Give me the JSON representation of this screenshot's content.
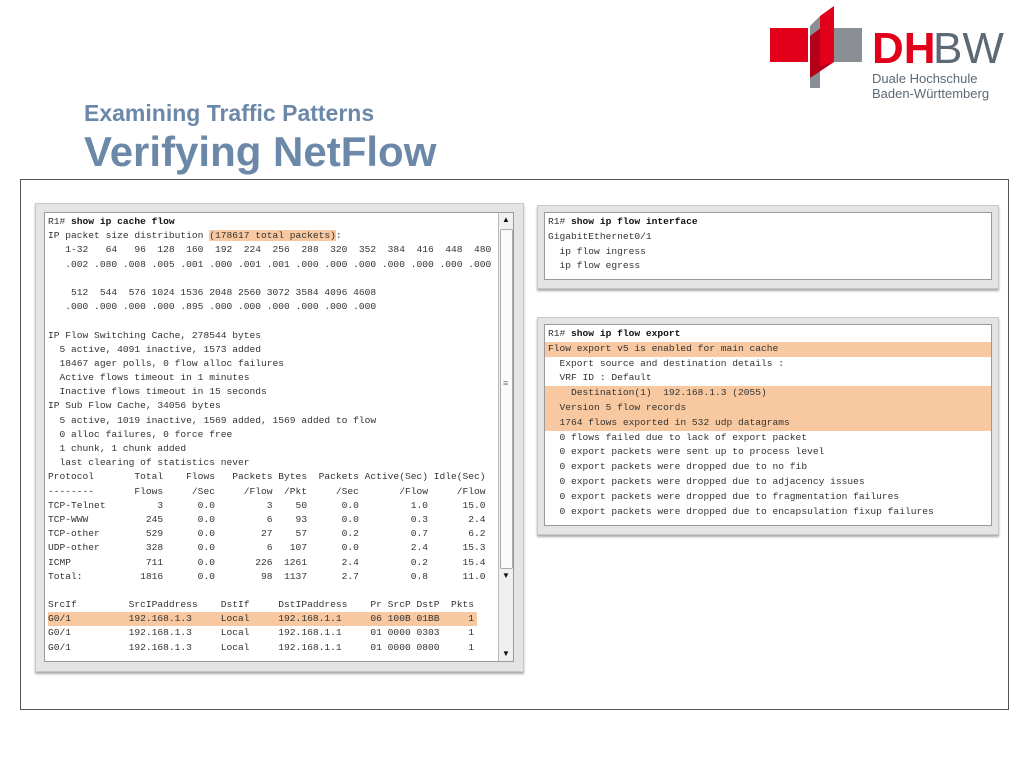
{
  "logo": {
    "brand": "DHBW",
    "line1": "Duale Hochschule",
    "line2": "Baden-Württemberg",
    "colors": {
      "red": "#e2001a",
      "grey": "#5d6a75"
    }
  },
  "header": {
    "subtitle": "Examining Traffic Patterns",
    "title": "Verifying NetFlow"
  },
  "cache_flow": {
    "intro": [
      [
        {
          "t": "R1# "
        },
        {
          "t": "show ip cache flow",
          "b": true
        }
      ],
      [
        {
          "t": "IP packet size distribution "
        },
        {
          "t": "(178617 total packets)",
          "hl": true
        },
        {
          "t": ":"
        }
      ],
      [
        {
          "t": "   1-32   64   96  128  160  192  224  256  288  320  352  384  416  448  480"
        }
      ],
      [
        {
          "t": "   .002 .080 .008 .005 .001 .000 .001 .001 .000 .000 .000 .000 .000 .000 .000"
        }
      ],
      [
        {
          "t": ""
        }
      ],
      [
        {
          "t": "    512  544  576 1024 1536 2048 2560 3072 3584 4096 4608"
        }
      ],
      [
        {
          "t": "   .000 .000 .000 .000 .895 .000 .000 .000 .000 .000 .000"
        }
      ],
      [
        {
          "t": ""
        }
      ],
      [
        {
          "t": "IP Flow Switching Cache, 278544 bytes"
        }
      ],
      [
        {
          "t": "  5 active, 4091 inactive, 1573 added"
        }
      ],
      [
        {
          "t": "  18467 ager polls, 0 flow alloc failures"
        }
      ],
      [
        {
          "t": "  Active flows timeout in 1 minutes"
        }
      ],
      [
        {
          "t": "  Inactive flows timeout in 15 seconds"
        }
      ],
      [
        {
          "t": "IP Sub Flow Cache, 34056 bytes"
        }
      ],
      [
        {
          "t": "  5 active, 1019 inactive, 1569 added, 1569 added to flow"
        }
      ],
      [
        {
          "t": "  0 alloc failures, 0 force free"
        }
      ],
      [
        {
          "t": "  1 chunk, 1 chunk added"
        }
      ],
      [
        {
          "t": "  last clearing of statistics never"
        }
      ]
    ],
    "protocol_table": {
      "header1": [
        "Protocol",
        "Total",
        "Flows",
        "Packets",
        "Bytes",
        "Packets",
        "Active(Sec)",
        "Idle(Sec)"
      ],
      "header2": [
        "--------",
        "Flows",
        "/Sec",
        "/Flow",
        "/Pkt",
        "/Sec",
        "/Flow",
        "/Flow"
      ],
      "rows": [
        [
          "TCP-Telnet",
          "3",
          "0.0",
          "3",
          "50",
          "0.0",
          "1.0",
          "15.0"
        ],
        [
          "TCP-WWW",
          "245",
          "0.0",
          "6",
          "93",
          "0.0",
          "0.3",
          "2.4"
        ],
        [
          "TCP-other",
          "529",
          "0.0",
          "27",
          "57",
          "0.2",
          "0.7",
          "6.2"
        ],
        [
          "UDP-other",
          "328",
          "0.0",
          "6",
          "107",
          "0.0",
          "2.4",
          "15.3"
        ],
        [
          "ICMP",
          "711",
          "0.0",
          "226",
          "1261",
          "2.4",
          "0.2",
          "15.4"
        ],
        [
          "Total:",
          "1816",
          "0.0",
          "98",
          "1137",
          "2.7",
          "0.8",
          "11.0"
        ]
      ]
    },
    "flow_table": {
      "header": [
        "SrcIf",
        "SrcIPaddress",
        "DstIf",
        "DstIPaddress",
        "Pr",
        "SrcP",
        "DstP",
        "Pkts"
      ],
      "rows": [
        {
          "cells": [
            "G0/1",
            "192.168.1.3",
            "Local",
            "192.168.1.1",
            "06",
            "100B",
            "01BB",
            "1"
          ],
          "hl": true
        },
        {
          "cells": [
            "G0/1",
            "192.168.1.3",
            "Local",
            "192.168.1.1",
            "01",
            "0000",
            "0303",
            "1"
          ]
        },
        {
          "cells": [
            "G0/1",
            "192.168.1.3",
            "Local",
            "192.168.1.1",
            "01",
            "0000",
            "0800",
            "1"
          ]
        }
      ]
    }
  },
  "flow_interface": {
    "lines": [
      [
        {
          "t": "R1# "
        },
        {
          "t": "show ip flow interface",
          "b": true
        }
      ],
      [
        {
          "t": "GigabitEthernet0/1"
        }
      ],
      [
        {
          "t": "  ip flow ingress"
        }
      ],
      [
        {
          "t": "  ip flow egress"
        }
      ]
    ]
  },
  "flow_export": {
    "lines": [
      {
        "seg": [
          {
            "t": "R1# "
          },
          {
            "t": "show ip flow export",
            "b": true
          }
        ]
      },
      {
        "seg": [
          {
            "t": "Flow export v5 is enabled for main cache"
          }
        ],
        "hl": true
      },
      {
        "seg": [
          {
            "t": "  Export source and destination details :"
          }
        ]
      },
      {
        "seg": [
          {
            "t": "  VRF ID : Default"
          }
        ]
      },
      {
        "seg": [
          {
            "t": "    Destination(1)  192.168.1.3 (2055)"
          }
        ],
        "hl": true
      },
      {
        "seg": [
          {
            "t": "  Version 5 flow records"
          }
        ],
        "hl": true
      },
      {
        "seg": [
          {
            "t": "  1764 flows exported in 532 udp datagrams"
          }
        ],
        "hl": true
      },
      {
        "seg": [
          {
            "t": "  0 flows failed due to lack of export packet"
          }
        ]
      },
      {
        "seg": [
          {
            "t": "  0 export packets were sent up to process level"
          }
        ]
      },
      {
        "seg": [
          {
            "t": "  0 export packets were dropped due to no fib"
          }
        ]
      },
      {
        "seg": [
          {
            "t": "  0 export packets were dropped due to adjacency issues"
          }
        ]
      },
      {
        "seg": [
          {
            "t": "  0 export packets were dropped due to fragmentation failures"
          }
        ]
      },
      {
        "seg": [
          {
            "t": "  0 export packets were dropped due to encapsulation fixup failures"
          }
        ]
      }
    ]
  },
  "highlight_color": "#f8c9a0"
}
